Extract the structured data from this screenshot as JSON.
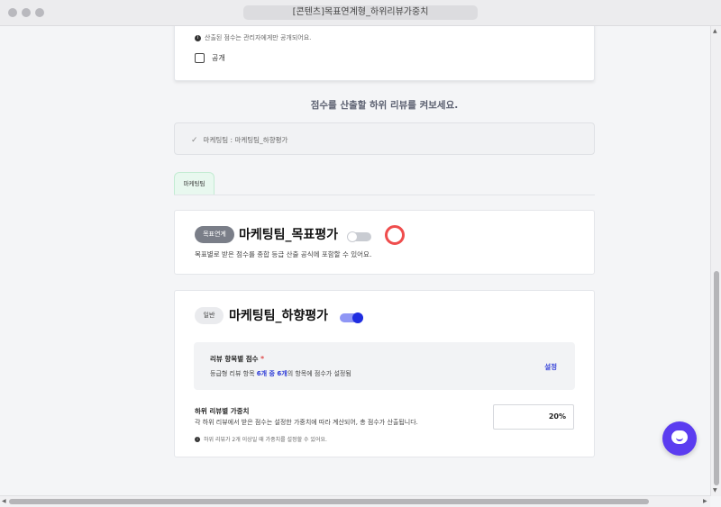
{
  "window": {
    "title": "[콘텐츠]목표연계형_하위리뷰가중치"
  },
  "top_card": {
    "info_text": "산출된 점수는 관리자에게만 공개되어요.",
    "checkbox_label": "공개"
  },
  "section_heading": "점수를 산출할 하위 리뷰를 켜보세요.",
  "selected": {
    "item": "마케팅팀 : 마케팅팀_하향평가"
  },
  "tab": {
    "label": "마케팅팀"
  },
  "goal_card": {
    "badge": "목표연계",
    "title": "마케팅팀_목표평가",
    "toggle_on": false,
    "description": "목표별로 받은 점수를 종합 등급 산출 공식에 포함할 수 있어요."
  },
  "review_card": {
    "badge": "일반",
    "title": "마케팅팀_하향평가",
    "toggle_on": true,
    "score_label": "리뷰 항목별 점수",
    "required_mark": "*",
    "score_desc_pre": "등급형 리뷰 항목 ",
    "score_desc_hl": "6개 중 6개",
    "score_desc_post": "의 항목에 점수가 설정됨",
    "set_link": "설정",
    "weight_label": "하위 리뷰별 가중치",
    "weight_desc": "각 하위 리뷰에서 받은 점수는 설정한 가중치에 따라 계산되어, 총 점수가 산출됩니다.",
    "weight_value": "20%",
    "note": "하위 리뷰가 2개 이상일 때 가중치를 설정할 수 있어요."
  },
  "colors": {
    "accent": "#1f2de0",
    "badge_goal": "#7a7e88",
    "required": "#e04848",
    "chat": "#5b3cf0",
    "ring": "#ef4d4d"
  },
  "icons": {
    "info": "info-icon",
    "check": "check-icon",
    "chat": "chat-icon"
  }
}
